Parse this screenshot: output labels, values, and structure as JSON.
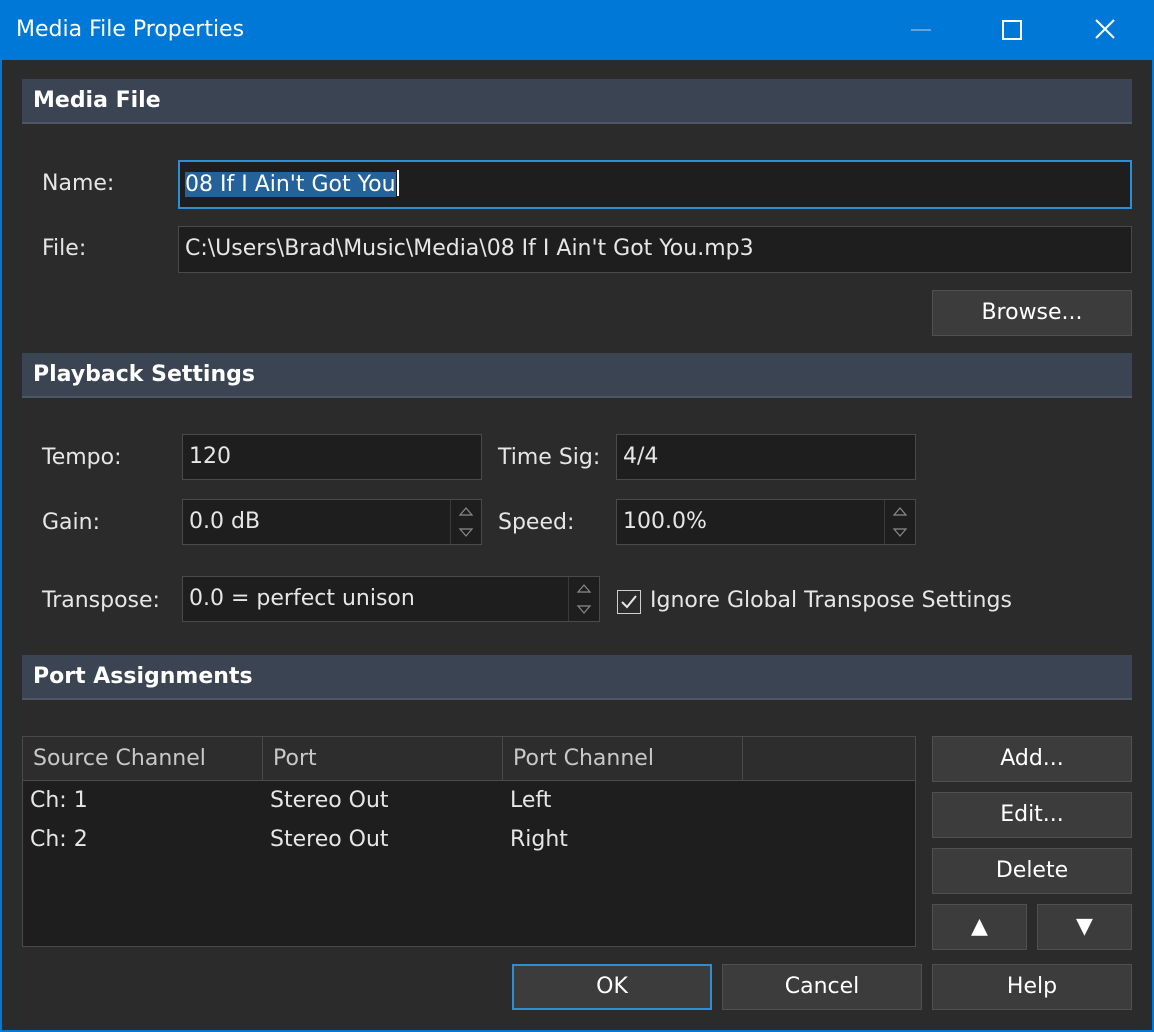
{
  "window": {
    "title": "Media File Properties"
  },
  "media_file": {
    "header": "Media File",
    "name_label": "Name:",
    "name_value": "08 If I Ain't Got You",
    "file_label": "File:",
    "file_value": "C:\\Users\\Brad\\Music\\Media\\08 If I Ain't Got You.mp3",
    "browse_label": "Browse..."
  },
  "playback": {
    "header": "Playback Settings",
    "tempo_label": "Tempo:",
    "tempo_value": "120",
    "timesig_label": "Time Sig:",
    "timesig_value": "4/4",
    "gain_label": "Gain:",
    "gain_value": "0.0 dB",
    "speed_label": "Speed:",
    "speed_value": "100.0%",
    "transpose_label": "Transpose:",
    "transpose_value": "0.0 = perfect unison",
    "ignore_global_label": "Ignore Global Transpose Settings",
    "ignore_global_checked": true
  },
  "ports": {
    "header": "Port Assignments",
    "columns": [
      "Source Channel",
      "Port",
      "Port Channel",
      ""
    ],
    "rows": [
      [
        "Ch: 1",
        "Stereo Out",
        "Left"
      ],
      [
        "Ch: 2",
        "Stereo Out",
        "Right"
      ]
    ],
    "add_label": "Add...",
    "edit_label": "Edit...",
    "delete_label": "Delete",
    "up_label": "▲",
    "down_label": "▼"
  },
  "footer": {
    "ok_label": "OK",
    "cancel_label": "Cancel",
    "help_label": "Help"
  },
  "colors": {
    "accent": "#0078d7",
    "focus": "#2b8fd6",
    "section": "#3a4452",
    "background": "#2b2b2b"
  },
  "icons": {
    "minimize": "minimize-icon",
    "maximize": "maximize-icon",
    "close": "close-icon",
    "check": "checkmark-icon",
    "spin_up": "spin-up-icon",
    "spin_down": "spin-down-icon"
  }
}
